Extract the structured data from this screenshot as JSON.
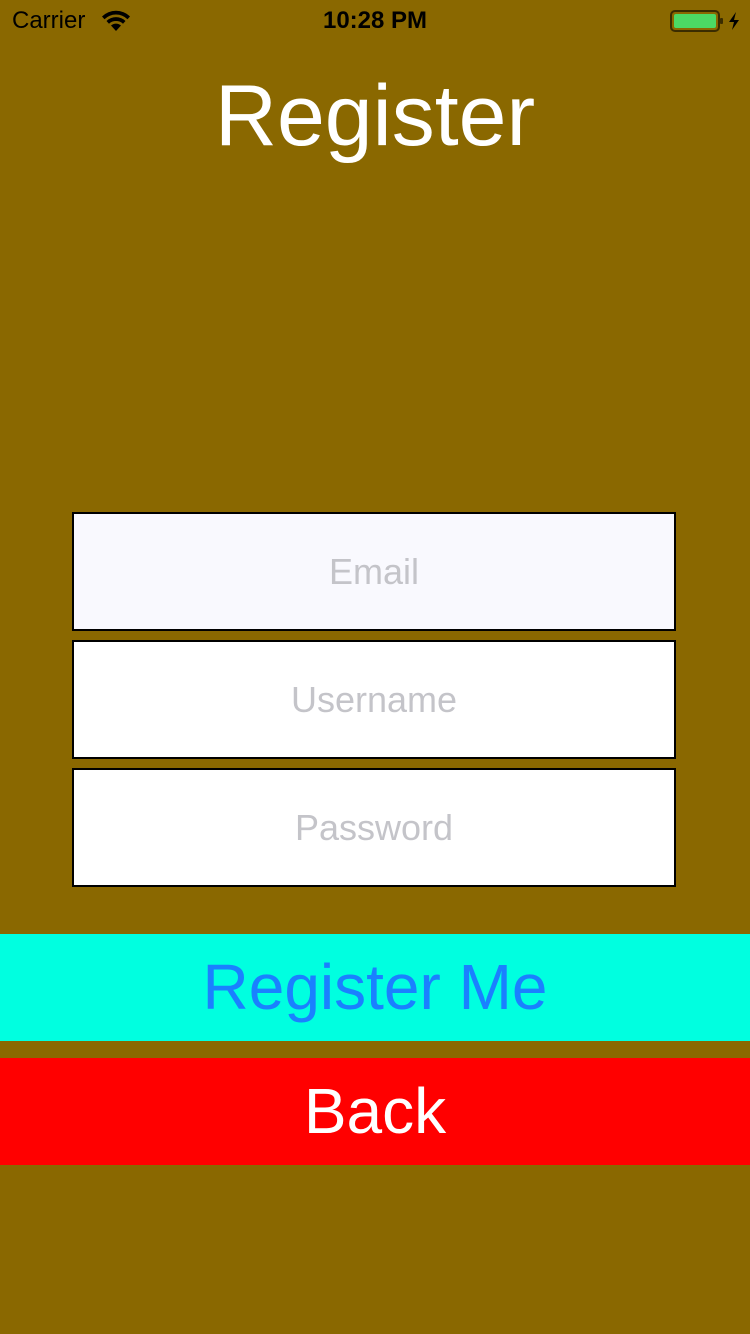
{
  "status_bar": {
    "carrier": "Carrier",
    "time": "10:28 PM",
    "battery_color": "#4cd964"
  },
  "title": "Register",
  "form": {
    "email_placeholder": "Email",
    "username_placeholder": "Username",
    "password_placeholder": "Password"
  },
  "buttons": {
    "register_label": "Register Me",
    "back_label": "Back"
  },
  "colors": {
    "background": "#8a6800",
    "register_bg": "#00ffe0",
    "register_text": "#1a80ff",
    "back_bg": "#ff0000",
    "back_text": "#ffffff"
  }
}
